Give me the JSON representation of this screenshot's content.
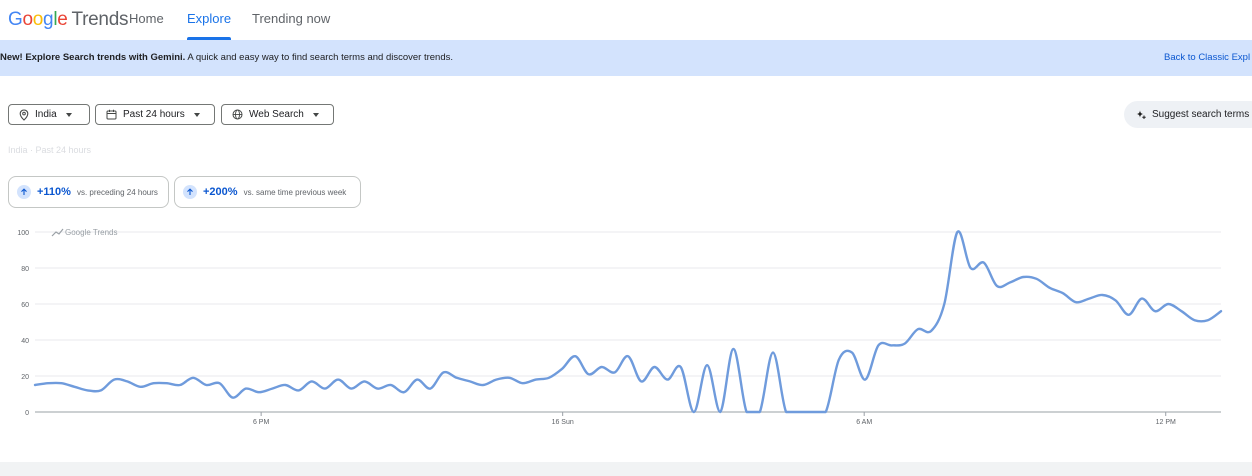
{
  "header": {
    "logo_text": "Google",
    "logo_suffix": "Trends",
    "nav": [
      {
        "label": "Home",
        "active": false
      },
      {
        "label": "Explore",
        "active": true
      },
      {
        "label": "Trending now",
        "active": false
      }
    ]
  },
  "banner": {
    "bold_text": "New! Explore Search trends with Gemini.",
    "text": " A quick and easy way to find search terms and discover trends.",
    "back_link": "Back to Classic Expl"
  },
  "filters": {
    "location": "India",
    "time_range": "Past 24 hours",
    "search_type": "Web Search",
    "suggest_label": "Suggest search terms"
  },
  "breadcrumb": "India · Past 24 hours",
  "stats": [
    {
      "value": "+110%",
      "description": "vs. preceding 24 hours"
    },
    {
      "value": "+200%",
      "description": "vs. same time previous week"
    }
  ],
  "colors": {
    "accent": "#1a73e8",
    "line": "#6f9bdc",
    "banner_bg": "#d3e3fd"
  },
  "chart_data": {
    "type": "line",
    "watermark": "Google Trends",
    "ylim": [
      0,
      100
    ],
    "y_ticks": [
      0,
      20,
      40,
      60,
      80,
      100
    ],
    "x_range": [
      0,
      118
    ],
    "x_ticks": [
      {
        "x": 22.5,
        "label": "6 PM"
      },
      {
        "x": 52.5,
        "label": "16 Sun"
      },
      {
        "x": 82.5,
        "label": "6 AM"
      },
      {
        "x": 112.5,
        "label": "12 PM"
      }
    ],
    "grid": true,
    "series": [
      {
        "values": [
          15,
          16,
          16,
          14,
          12,
          12,
          18,
          17,
          14,
          16,
          16,
          15,
          19,
          15,
          16,
          8,
          13,
          11,
          13,
          15,
          12,
          17,
          13,
          18,
          13,
          17,
          13,
          15,
          11,
          18,
          13,
          22,
          19,
          17,
          15,
          18,
          19,
          16,
          18,
          19,
          24,
          31,
          21,
          25,
          22,
          31,
          17,
          25,
          18,
          25,
          0,
          26,
          0,
          35,
          0,
          0,
          33,
          0,
          0,
          0,
          0,
          29,
          33,
          18,
          37,
          37,
          38,
          46,
          45,
          60,
          100,
          80,
          83,
          70,
          72,
          75,
          74,
          69,
          66,
          61,
          63,
          65,
          62,
          54,
          63,
          56,
          60,
          56,
          51,
          51,
          56
        ]
      }
    ]
  }
}
